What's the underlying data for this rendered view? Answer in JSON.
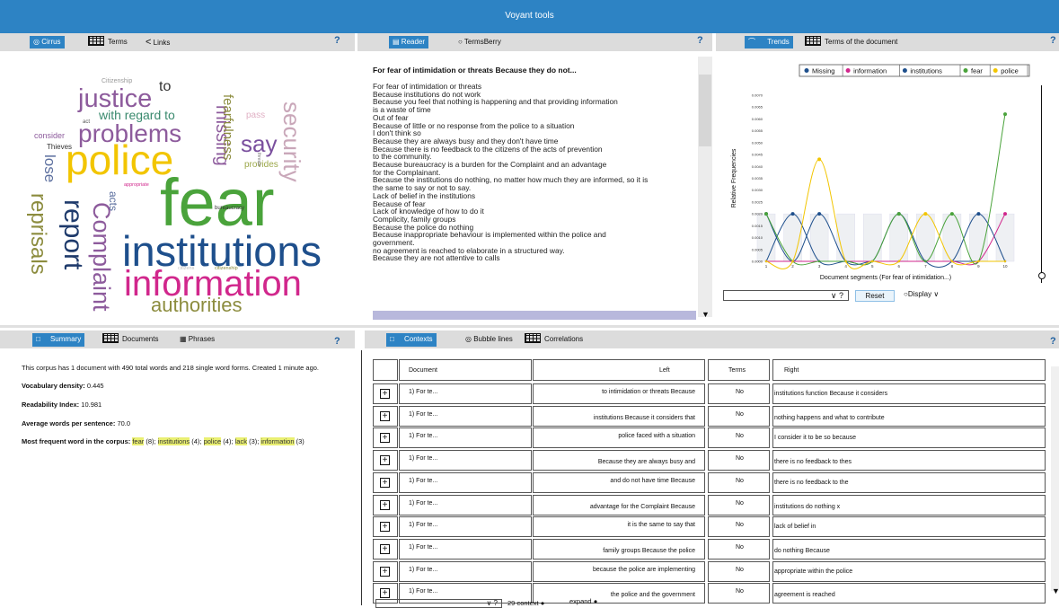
{
  "app_title": "Voyant tools",
  "help": "?",
  "panel1": {
    "tabs": [
      "Cirrus",
      "Terms",
      "Links"
    ],
    "words": [
      {
        "text": "fear",
        "color": "#4aa33b"
      },
      {
        "text": "institutions",
        "color": "#1e4f8c"
      },
      {
        "text": "information",
        "color": "#d1278c"
      },
      {
        "text": "police",
        "color": "#f2c500"
      },
      {
        "text": "authorities",
        "color": "#8c8c3e"
      },
      {
        "text": "problems",
        "color": "#8d5b9c"
      },
      {
        "text": "justice",
        "color": "#8d5b9c"
      },
      {
        "text": "report",
        "color": "#1e3a6b"
      },
      {
        "text": "Complaint",
        "color": "#8d5b9c"
      },
      {
        "text": "reprisals",
        "color": "#8c8c3e"
      },
      {
        "text": "security",
        "color": "#c9a7b9"
      },
      {
        "text": "say",
        "color": "#7a4f9e"
      },
      {
        "text": "missing",
        "color": "#8d5b9c"
      },
      {
        "text": "fearfulness",
        "color": "#8c8c3e"
      },
      {
        "text": "with regard to",
        "color": "#3a8a6e"
      },
      {
        "text": "to",
        "color": "#333333"
      },
      {
        "text": "lose",
        "color": "#5b6e9e"
      },
      {
        "text": "acts",
        "color": "#5b6e9e"
      },
      {
        "text": "Citizenship",
        "color": "#9a9a9a"
      },
      {
        "text": "consider",
        "color": "#8d5b9c"
      },
      {
        "text": "Thieves",
        "color": "#333333"
      },
      {
        "text": "act",
        "color": "#555555"
      },
      {
        "text": "pass",
        "color": "#e0b0c4"
      },
      {
        "text": "provides",
        "color": "#9ca84a"
      },
      {
        "text": "threats",
        "color": "#777777"
      },
      {
        "text": "appropriate",
        "color": "#d1278c"
      },
      {
        "text": "bureaucracy",
        "color": "#333333"
      },
      {
        "text": "citizens",
        "color": "#c0c0c0"
      },
      {
        "text": "citizenship",
        "color": "#8c8c3e"
      }
    ]
  },
  "panel2": {
    "tabs": [
      "Reader",
      "TermsBerry"
    ],
    "title": "For fear of intimidation or threats Because they do not...",
    "lines": [
      "For fear of intimidation or threats",
      "Because institutions do not work",
      "Because you feel that nothing is happening and that providing information",
      "is a waste of time",
      "Out of fear",
      "Because of little or no response from the police to a situation",
      "I don't think so",
      "Because they are always busy and they don't have time",
      "Because there is no feedback to the citizens of the acts of prevention",
      "to the community.",
      "Because bureaucracy is a burden for the Complaint and an advantage",
      "for the Complainant.",
      "Because the institutions do nothing, no matter how much they are informed, so it is",
      "the same to say or not to say.",
      "Lack of belief in the institutions",
      "Because of fear",
      "Lack of knowledge of how to do it",
      "Complicity, family groups",
      "Because the police do nothing",
      "Because inappropriate behaviour is implemented within the police and",
      "government.",
      "no agreement is reached to elaborate in a structured way.",
      "Because they are not attentive to calls"
    ]
  },
  "panel3": {
    "tabs": [
      "Trends",
      "Terms of the document"
    ],
    "legend": [
      {
        "name": "Missing",
        "color": "#1e4f8c"
      },
      {
        "name": "information",
        "color": "#d1278c"
      },
      {
        "name": "institutions",
        "color": "#1e4f8c"
      },
      {
        "name": "fear",
        "color": "#4aa33b"
      },
      {
        "name": "police",
        "color": "#f2c500"
      }
    ],
    "reset_label": "Reset",
    "display_label": "Display",
    "select_value": "∨ ?"
  },
  "chart_data": {
    "type": "line",
    "xlabel": "Document segments (For fear of intimidation...)",
    "ylabel": "Relative Frequencies",
    "x": [
      1,
      2,
      3,
      4,
      5,
      6,
      7,
      8,
      9,
      10
    ],
    "y_ticks": [
      "0.0000",
      "0.0005",
      "0.0010",
      "0.0015",
      "0.0020",
      "0.0025",
      "0.0030",
      "0.0035",
      "0.0040",
      "0.0045",
      "0.0050",
      "0.0055",
      "0.0060",
      "0.0065",
      "0.0070"
    ],
    "ylim": [
      0,
      0.007
    ],
    "series": [
      {
        "name": "Missing",
        "color": "#1e4f8c",
        "values": [
          0.002,
          0,
          0.002,
          0,
          0,
          0,
          0,
          0,
          0,
          0
        ]
      },
      {
        "name": "information",
        "color": "#d1278c",
        "values": [
          0,
          0,
          0,
          0,
          0,
          0,
          0,
          0,
          0,
          0.002
        ]
      },
      {
        "name": "institutions",
        "color": "#1e4f8c",
        "values": [
          0,
          0.002,
          0,
          0,
          0,
          0.002,
          0,
          0,
          0.002,
          0
        ]
      },
      {
        "name": "fear",
        "color": "#4aa33b",
        "values": [
          0.002,
          0,
          0,
          0,
          0,
          0.002,
          0,
          0.002,
          0,
          0.0062
        ]
      },
      {
        "name": "police",
        "color": "#f2c500",
        "values": [
          0,
          0,
          0.0043,
          0,
          0,
          0,
          0.002,
          0,
          0,
          0
        ]
      }
    ]
  },
  "panel4": {
    "tabs": [
      "Summary",
      "Documents",
      "Phrases"
    ],
    "intro": "This corpus has 1 document with 490 total words and 218 single word forms. Created 1 minute ago.",
    "vocab_label": "Vocabulary density:",
    "vocab_value": "0.445",
    "read_label": "Readability Index:",
    "read_value": "10.981",
    "avg_label": "Average words per sentence:",
    "avg_value": "70.0",
    "freq_label": "Most frequent word in the corpus:",
    "freq_words": [
      {
        "word": "fear",
        "count": " (8);"
      },
      {
        "word": "institutions",
        "count": " (4);"
      },
      {
        "word": "police",
        "count": " (4);"
      },
      {
        "word": "lack",
        "count": " (3);"
      },
      {
        "word": "information",
        "count": " (3)"
      }
    ]
  },
  "panel5": {
    "tabs": [
      "Contexts",
      "Bubble lines",
      "Correlations"
    ],
    "headers": [
      "Document",
      "Left",
      "Terms",
      "Right"
    ],
    "rows": [
      {
        "doc": "1)  For te...",
        "left": "to intimidation or threats Because",
        "term": "No",
        "right": "institutions function Because it considers"
      },
      {
        "doc": "1)  For te...",
        "left": "institutions Because it considers that",
        "term": "No",
        "right": "nothing happens and what to contribute"
      },
      {
        "doc": "1)  For te...",
        "left": "police faced with a situation",
        "term": "No",
        "right": "I consider it to be so because"
      },
      {
        "doc": "1)  For te...",
        "left": "Because they are always busy and",
        "term": "No",
        "right": "there is no feedback to thes"
      },
      {
        "doc": "1)  For te...",
        "left": "and do not have time Because",
        "term": "No",
        "right": "there is no feedback to the"
      },
      {
        "doc": "1)  For te...",
        "left": "advantage for the Complaint Because",
        "term": "No",
        "right": "institutions do nothing x"
      },
      {
        "doc": "1)  For te...",
        "left": "it is the same to say that",
        "term": "No",
        "right": "lack of belief in"
      },
      {
        "doc": "1)  For te...",
        "left": "family groups Because the police",
        "term": "No",
        "right": " do nothing Because"
      },
      {
        "doc": "1)  For te...",
        "left": "because the police are implementing",
        "term": "No",
        "right": "appropriate within the police"
      },
      {
        "doc": "1)  For te...",
        "left": "the police and the government",
        "term": "No",
        "right": "agreement is reached"
      }
    ],
    "footer_select": "∨ ?",
    "footer_context_num": "29",
    "footer_context_label": "context",
    "footer_expand_label": "expand"
  }
}
